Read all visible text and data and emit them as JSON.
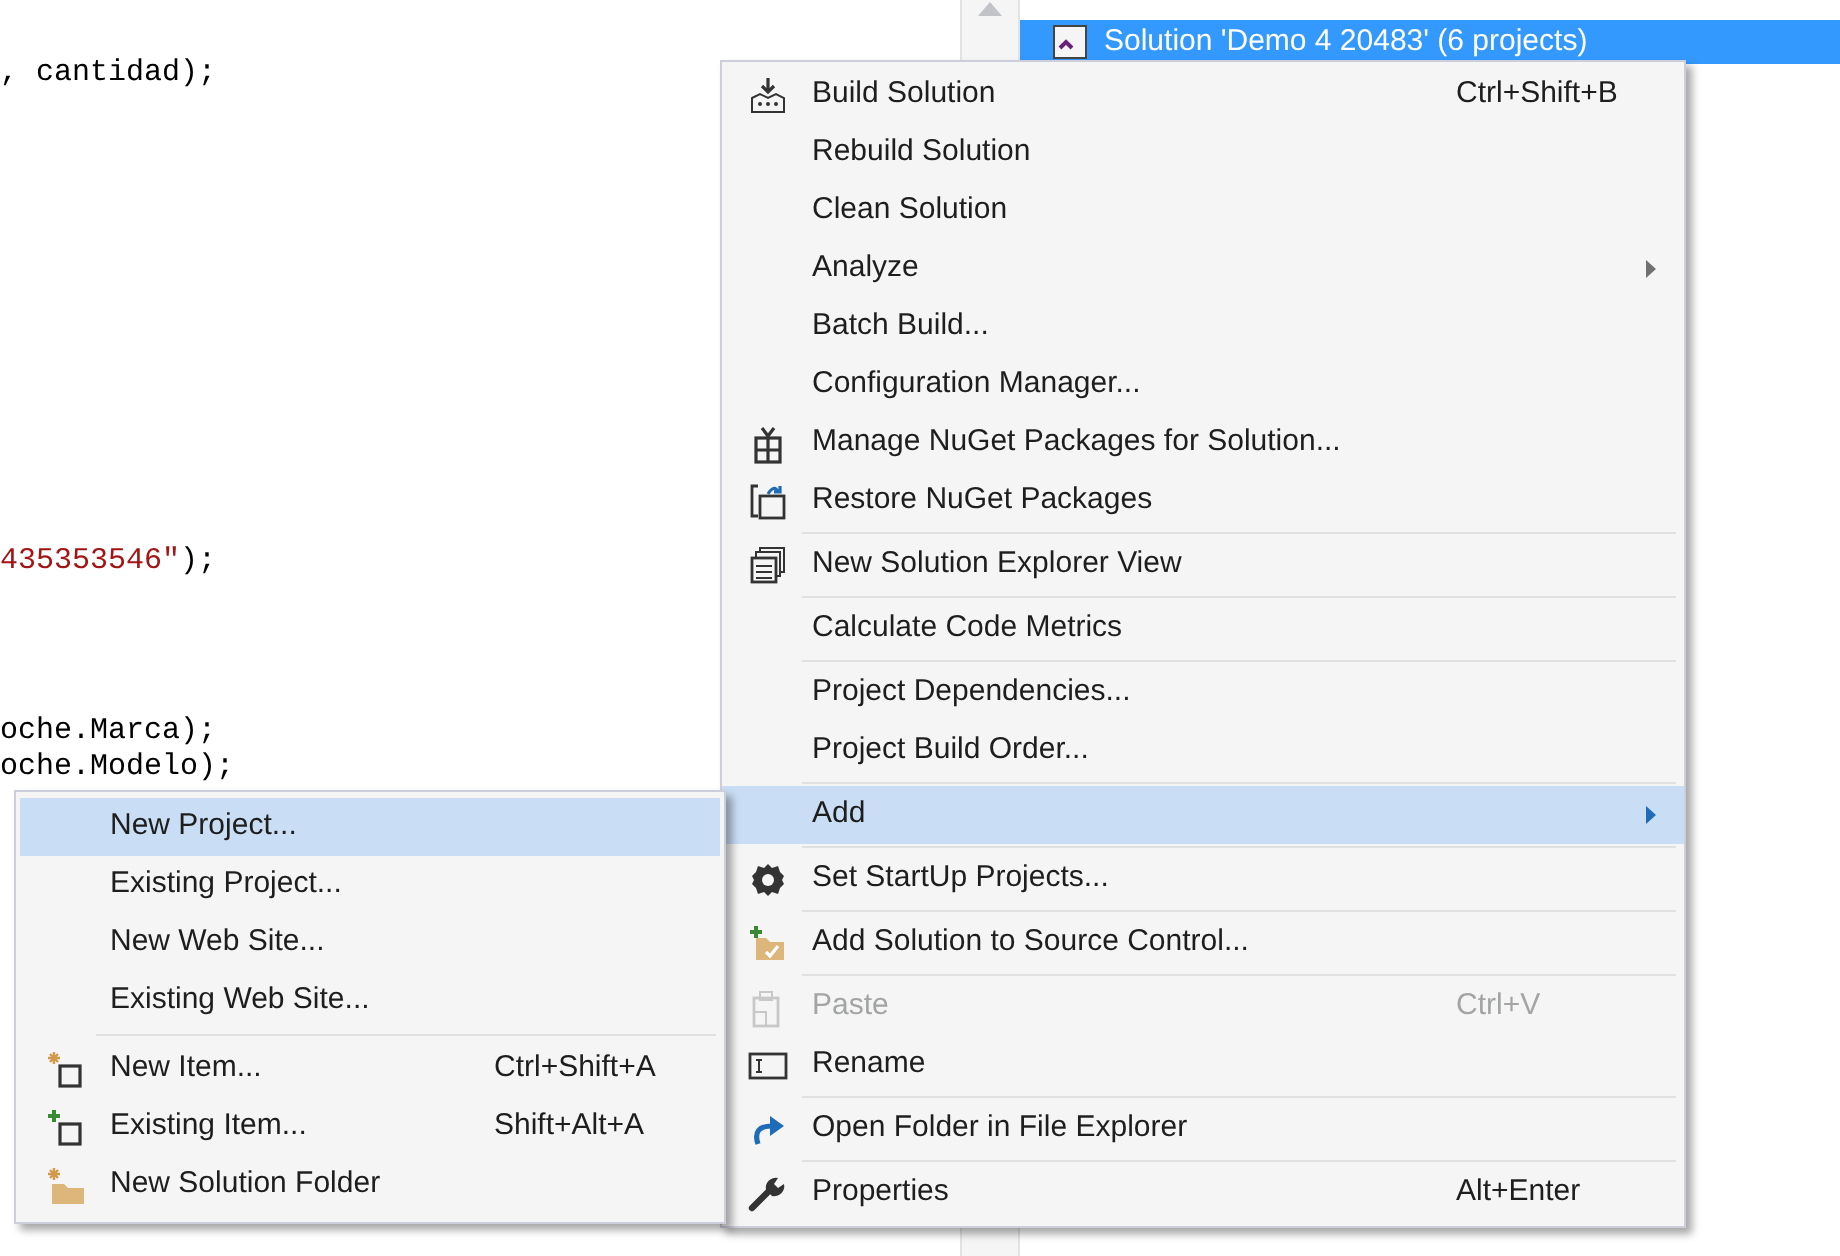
{
  "editor": {
    "lines": [
      {
        "parts": [
          {
            "text": ", cantidad);",
            "kind": "plain"
          }
        ]
      },
      {
        "parts": [
          {
            "text": "435353546\"",
            "kind": "string"
          },
          {
            "text": ");",
            "kind": "plain"
          }
        ]
      },
      {
        "parts": [
          {
            "text": "oche.Marca);",
            "kind": "plain"
          }
        ]
      },
      {
        "parts": [
          {
            "text": "oche.Modelo);",
            "kind": "plain"
          }
        ]
      }
    ]
  },
  "solution_explorer": {
    "selected_node": {
      "label": "Solution 'Demo 4 20483' (6 projects)",
      "selected": true
    }
  },
  "context_menu": {
    "items": [
      {
        "kind": "item",
        "label": "Build Solution",
        "shortcut": "Ctrl+Shift+B",
        "submenu": false,
        "selected": false,
        "disabled": false
      },
      {
        "kind": "item",
        "label": "Rebuild Solution",
        "submenu": false,
        "selected": false,
        "disabled": false
      },
      {
        "kind": "item",
        "label": "Clean Solution",
        "submenu": false,
        "selected": false,
        "disabled": false
      },
      {
        "kind": "item",
        "label": "Analyze",
        "submenu": true,
        "selected": false,
        "disabled": false
      },
      {
        "kind": "item",
        "label": "Batch Build...",
        "submenu": false,
        "selected": false,
        "disabled": false
      },
      {
        "kind": "item",
        "label": "Configuration Manager...",
        "submenu": false,
        "selected": false,
        "disabled": false
      },
      {
        "kind": "item",
        "label": "Manage NuGet Packages for Solution...",
        "submenu": false,
        "selected": false,
        "disabled": false
      },
      {
        "kind": "item",
        "label": "Restore NuGet Packages",
        "submenu": false,
        "selected": false,
        "disabled": false
      },
      {
        "kind": "separator"
      },
      {
        "kind": "item",
        "label": "New Solution Explorer View",
        "submenu": false,
        "selected": false,
        "disabled": false
      },
      {
        "kind": "separator"
      },
      {
        "kind": "item",
        "label": "Calculate Code Metrics",
        "submenu": false,
        "selected": false,
        "disabled": false
      },
      {
        "kind": "separator"
      },
      {
        "kind": "item",
        "label": "Project Dependencies...",
        "submenu": false,
        "selected": false,
        "disabled": false
      },
      {
        "kind": "item",
        "label": "Project Build Order...",
        "submenu": false,
        "selected": false,
        "disabled": false
      },
      {
        "kind": "separator"
      },
      {
        "kind": "item",
        "label": "Add",
        "submenu": true,
        "selected": true,
        "disabled": false
      },
      {
        "kind": "separator"
      },
      {
        "kind": "item",
        "label": "Set StartUp Projects...",
        "submenu": false,
        "selected": false,
        "disabled": false
      },
      {
        "kind": "separator"
      },
      {
        "kind": "item",
        "label": "Add Solution to Source Control...",
        "submenu": false,
        "selected": false,
        "disabled": false
      },
      {
        "kind": "separator"
      },
      {
        "kind": "item",
        "label": "Paste",
        "shortcut": "Ctrl+V",
        "submenu": false,
        "selected": false,
        "disabled": true
      },
      {
        "kind": "item",
        "label": "Rename",
        "submenu": false,
        "selected": false,
        "disabled": false
      },
      {
        "kind": "separator"
      },
      {
        "kind": "item",
        "label": "Open Folder in File Explorer",
        "submenu": false,
        "selected": false,
        "disabled": false
      },
      {
        "kind": "separator"
      },
      {
        "kind": "item",
        "label": "Properties",
        "shortcut": "Alt+Enter",
        "submenu": false,
        "selected": false,
        "disabled": false
      }
    ]
  },
  "add_submenu": {
    "items": [
      {
        "kind": "item",
        "label": "New Project...",
        "selected": true
      },
      {
        "kind": "item",
        "label": "Existing Project...",
        "selected": false
      },
      {
        "kind": "item",
        "label": "New Web Site...",
        "selected": false
      },
      {
        "kind": "item",
        "label": "Existing Web Site...",
        "selected": false
      },
      {
        "kind": "separator"
      },
      {
        "kind": "item",
        "label": "New Item...",
        "shortcut": "Ctrl+Shift+A",
        "selected": false
      },
      {
        "kind": "item",
        "label": "Existing Item...",
        "shortcut": "Shift+Alt+A",
        "selected": false
      },
      {
        "kind": "item",
        "label": "New Solution Folder",
        "selected": false
      }
    ]
  }
}
